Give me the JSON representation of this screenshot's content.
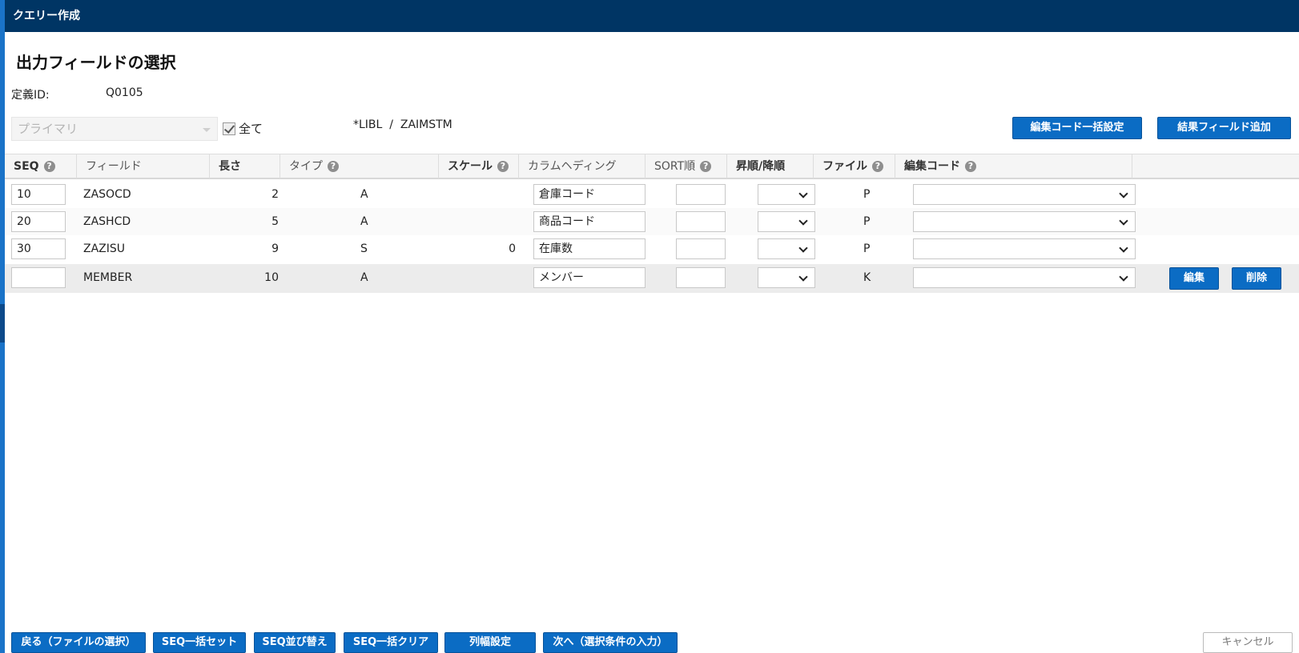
{
  "window": {
    "title": "クエリー作成"
  },
  "page": {
    "title": "出力フィールドの選択",
    "definition_label": "定義ID:",
    "definition_value": "Q0105",
    "primary_select_placeholder": "プライマリ",
    "all_checkbox_label": "全て",
    "all_checked": true,
    "library_path": "*LIBL  /  ZAIMSTM"
  },
  "toolbar": {
    "bulk_edit_code": "編集コード一括設定",
    "add_result_field": "結果フィールド追加"
  },
  "table": {
    "headers": {
      "seq": "SEQ",
      "field": "フィールド",
      "length": "長さ",
      "type": "タイプ",
      "scale": "スケール",
      "column_heading": "カラムヘディング",
      "sort": "SORT順",
      "order": "昇順/降順",
      "file": "ファイル",
      "edit_code": "編集コード"
    },
    "rows": [
      {
        "seq": "10",
        "field": "ZASOCD",
        "length": "2",
        "type": "A",
        "scale": "",
        "heading": "倉庫コード",
        "sort": "",
        "order": "",
        "file": "P",
        "edit_code": ""
      },
      {
        "seq": "20",
        "field": "ZASHCD",
        "length": "5",
        "type": "A",
        "scale": "",
        "heading": "商品コード",
        "sort": "",
        "order": "",
        "file": "P",
        "edit_code": ""
      },
      {
        "seq": "30",
        "field": "ZAZISU",
        "length": "9",
        "type": "S",
        "scale": "0",
        "heading": "在庫数",
        "sort": "",
        "order": "",
        "file": "P",
        "edit_code": ""
      },
      {
        "seq": "",
        "field": "MEMBER",
        "length": "10",
        "type": "A",
        "scale": "",
        "heading": "メンバー",
        "sort": "",
        "order": "",
        "file": "K",
        "edit_code": "",
        "edit_label": "編集",
        "delete_label": "削除"
      }
    ]
  },
  "footer": {
    "back": "戻る（ファイルの選択）",
    "seq_bulk_set": "SEQ一括セット",
    "seq_sort": "SEQ並び替え",
    "seq_bulk_clear": "SEQ一括クリア",
    "column_width": "列幅設定",
    "next": "次へ（選択条件の入力）",
    "cancel": "キャンセル"
  },
  "help_glyph": "?",
  "colors": {
    "titlebar": "#003564",
    "accent": "#0b6cc4",
    "left_edge": "#1a73c8"
  }
}
